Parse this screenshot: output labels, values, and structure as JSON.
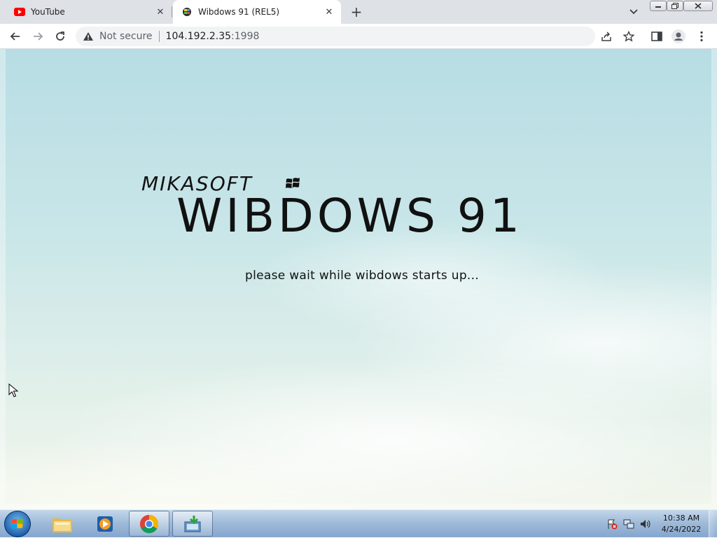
{
  "browser": {
    "tabs": [
      {
        "title": "YouTube",
        "favicon": "youtube-icon"
      },
      {
        "title": "Wibdows 91 (REL5)",
        "favicon": "wibdows-icon",
        "active": true
      }
    ],
    "new_tab_label": "+",
    "address": {
      "security_label": "Not secure",
      "host": "104.192.2.35",
      "port": ":1998"
    },
    "icons": [
      "back-icon",
      "forward-icon",
      "reload-icon",
      "share-icon",
      "star-icon",
      "side-panel-icon",
      "profile-icon",
      "menu-icon",
      "tab-search-icon"
    ]
  },
  "page": {
    "brand": "MIKASOFT",
    "title": "WIBDOWS 91",
    "message": "please wait while wibdows starts up..."
  },
  "taskbar": {
    "apps": [
      "windows-explorer-icon",
      "media-player-icon",
      "chrome-icon",
      "installer-icon"
    ],
    "clock": {
      "time": "10:38 AM",
      "date": "4/24/2022"
    }
  },
  "colors": {
    "tab_strip": "#dee1e6",
    "youtube_red": "#ff0000",
    "taskbar": "#9db9d8",
    "sky": "#c9e6e8"
  }
}
